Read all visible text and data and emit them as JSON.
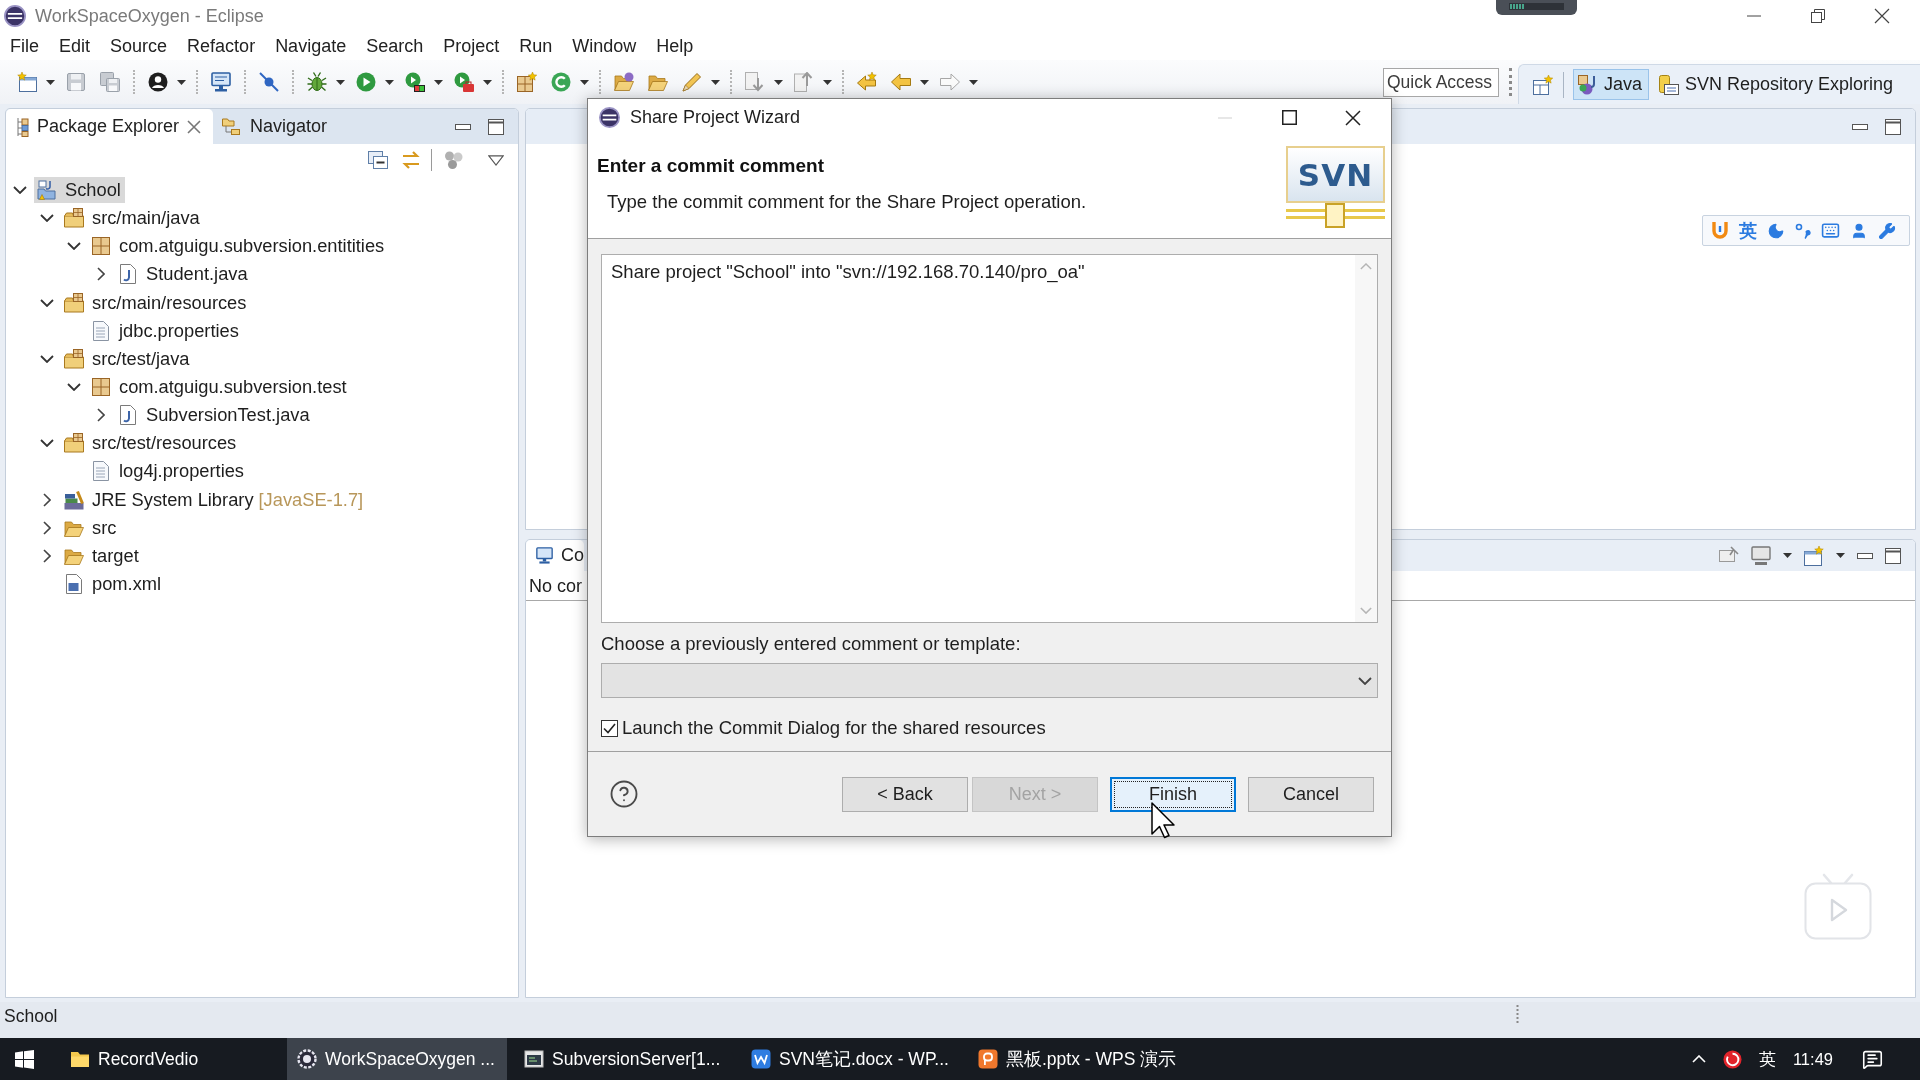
{
  "window": {
    "title": "WorkSpaceOxygen - Eclipse"
  },
  "menu_bar": [
    "File",
    "Edit",
    "Source",
    "Refactor",
    "Navigate",
    "Search",
    "Project",
    "Run",
    "Window",
    "Help"
  ],
  "toolbar": {
    "quick_access": {
      "placeholder": "Quick Access"
    },
    "perspectives": [
      {
        "label": "Java",
        "selected": true
      },
      {
        "label": "SVN Repository Exploring",
        "selected": false
      }
    ]
  },
  "package_explorer": {
    "tabs": [
      {
        "label": "Package Explorer",
        "selected": true
      },
      {
        "label": "Navigator",
        "selected": false
      }
    ],
    "tree": [
      {
        "label": "School",
        "kind": "project",
        "expanded": true,
        "selected": true,
        "children": [
          {
            "label": "src/main/java",
            "kind": "source-folder",
            "expanded": true,
            "selected": false,
            "children": [
              {
                "label": "com.atguigu.subversion.entitities",
                "kind": "package",
                "expanded": true,
                "selected": false,
                "children": [
                  {
                    "label": "Student.java",
                    "kind": "java-file",
                    "expanded": false,
                    "selected": false
                  }
                ]
              }
            ]
          },
          {
            "label": "src/main/resources",
            "kind": "source-folder",
            "expanded": true,
            "selected": false,
            "children": [
              {
                "label": "jdbc.properties",
                "kind": "properties-file",
                "selected": false
              }
            ]
          },
          {
            "label": "src/test/java",
            "kind": "source-folder",
            "expanded": true,
            "selected": false,
            "children": [
              {
                "label": "com.atguigu.subversion.test",
                "kind": "package",
                "expanded": true,
                "selected": false,
                "children": [
                  {
                    "label": "SubversionTest.java",
                    "kind": "java-file",
                    "expanded": false,
                    "selected": false
                  }
                ]
              }
            ]
          },
          {
            "label": "src/test/resources",
            "kind": "source-folder",
            "expanded": true,
            "selected": false,
            "children": [
              {
                "label": "log4j.properties",
                "kind": "properties-file",
                "selected": false
              }
            ]
          },
          {
            "label": "JRE System Library",
            "decoration": "[JavaSE-1.7]",
            "kind": "library",
            "expanded": false,
            "selected": false
          },
          {
            "label": "src",
            "kind": "folder",
            "expanded": false,
            "selected": false
          },
          {
            "label": "target",
            "kind": "folder",
            "expanded": false,
            "selected": false
          },
          {
            "label": "pom.xml",
            "kind": "xml-file",
            "selected": false
          }
        ]
      }
    ]
  },
  "console": {
    "tab": "Co",
    "message": "No cor"
  },
  "ime_toolbar": {
    "language": "英"
  },
  "dialog": {
    "title": "Share Project Wizard",
    "heading": "Enter a commit comment",
    "description": "Type the commit comment for the Share Project operation.",
    "logo_text": "SVN",
    "comment": "Share project \"School\" into \"svn://192.168.70.140/pro_oa\"",
    "template_label": "Choose a previously entered comment or template:",
    "launch_commit_dialog": {
      "label": "Launch the Commit Dialog for the shared resources",
      "checked": true
    },
    "buttons": [
      {
        "label": "< Back",
        "disabled": false,
        "default": false
      },
      {
        "label": "Next >",
        "disabled": true,
        "default": false
      },
      {
        "label": "Finish",
        "disabled": false,
        "default": true
      },
      {
        "label": "Cancel",
        "disabled": false,
        "default": false
      }
    ]
  },
  "status_bar": {
    "text": "School"
  },
  "taskbar": {
    "items": [
      {
        "label": "RecordVedio",
        "kind": "folder",
        "selected": false
      },
      {
        "label": "WorkSpaceOxygen ...",
        "kind": "ide",
        "selected": true
      },
      {
        "label": "SubversionServer[1...",
        "kind": "server",
        "selected": false
      },
      {
        "label": "SVN笔记.docx - WP...",
        "kind": "document",
        "selected": false
      },
      {
        "label": "黑板.pptx - WPS 演示",
        "kind": "presentation",
        "selected": false
      }
    ],
    "tray": {
      "language": "英",
      "time": "11:49"
    }
  }
}
